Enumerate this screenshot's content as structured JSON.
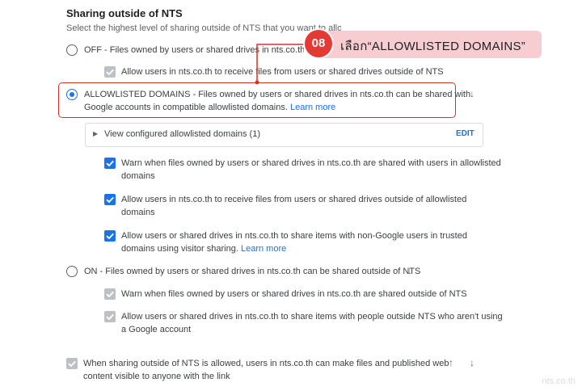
{
  "section": {
    "title": "Sharing outside of NTS",
    "subtitle": "Select the highest level of sharing outside of NTS that you want to allow"
  },
  "options": {
    "off": {
      "label": "OFF - Files owned by users or shared drives in nts.co.th cannot be shared outside of NTS",
      "sub": "Allow users in nts.co.th to receive files from users or shared drives outside of NTS"
    },
    "allowlisted": {
      "label_line1": "ALLOWLISTED DOMAINS - Files owned by users or shared drives in nts.co.th can be shared with",
      "label_line2": "Google accounts in compatible allowlisted domains.",
      "learn_more": "Learn more",
      "configured": "View configured allowlisted domains (1)",
      "edit": "EDIT",
      "checks": [
        {
          "line1": "Warn when files owned by users or shared drives in nts.co.th are shared with users in allowlisted",
          "line2": "domains"
        },
        {
          "line1": "Allow users in nts.co.th to receive files from users or shared drives outside of allowlisted",
          "line2": "domains"
        },
        {
          "line1": "Allow users or shared drives in nts.co.th to share items with non-Google users in trusted",
          "line2": "domains using visitor sharing.",
          "learn_more": "Learn more"
        }
      ]
    },
    "on": {
      "label": "ON - Files owned by users or shared drives in nts.co.th can be shared outside of NTS",
      "checks": [
        {
          "line1": "Warn when files owned by users or shared drives in nts.co.th are shared outside of NTS"
        },
        {
          "line1": "Allow users or shared drives in nts.co.th to share items with people outside NTS who aren't using",
          "line2": "a Google account"
        }
      ]
    }
  },
  "publish": {
    "line1": "When sharing outside of NTS is allowed, users in nts.co.th can make files and published web",
    "line2": "content visible to anyone with the link"
  },
  "callout": {
    "step": "08",
    "text": "เลือก“ALLOWLISTED DOMAINS”"
  },
  "watermark": "nts.co.th",
  "colors": {
    "accent": "#1a73e8",
    "callout_red": "#e53935",
    "highlight_border": "#d93025",
    "callout_bg": "#f8cdd1"
  }
}
